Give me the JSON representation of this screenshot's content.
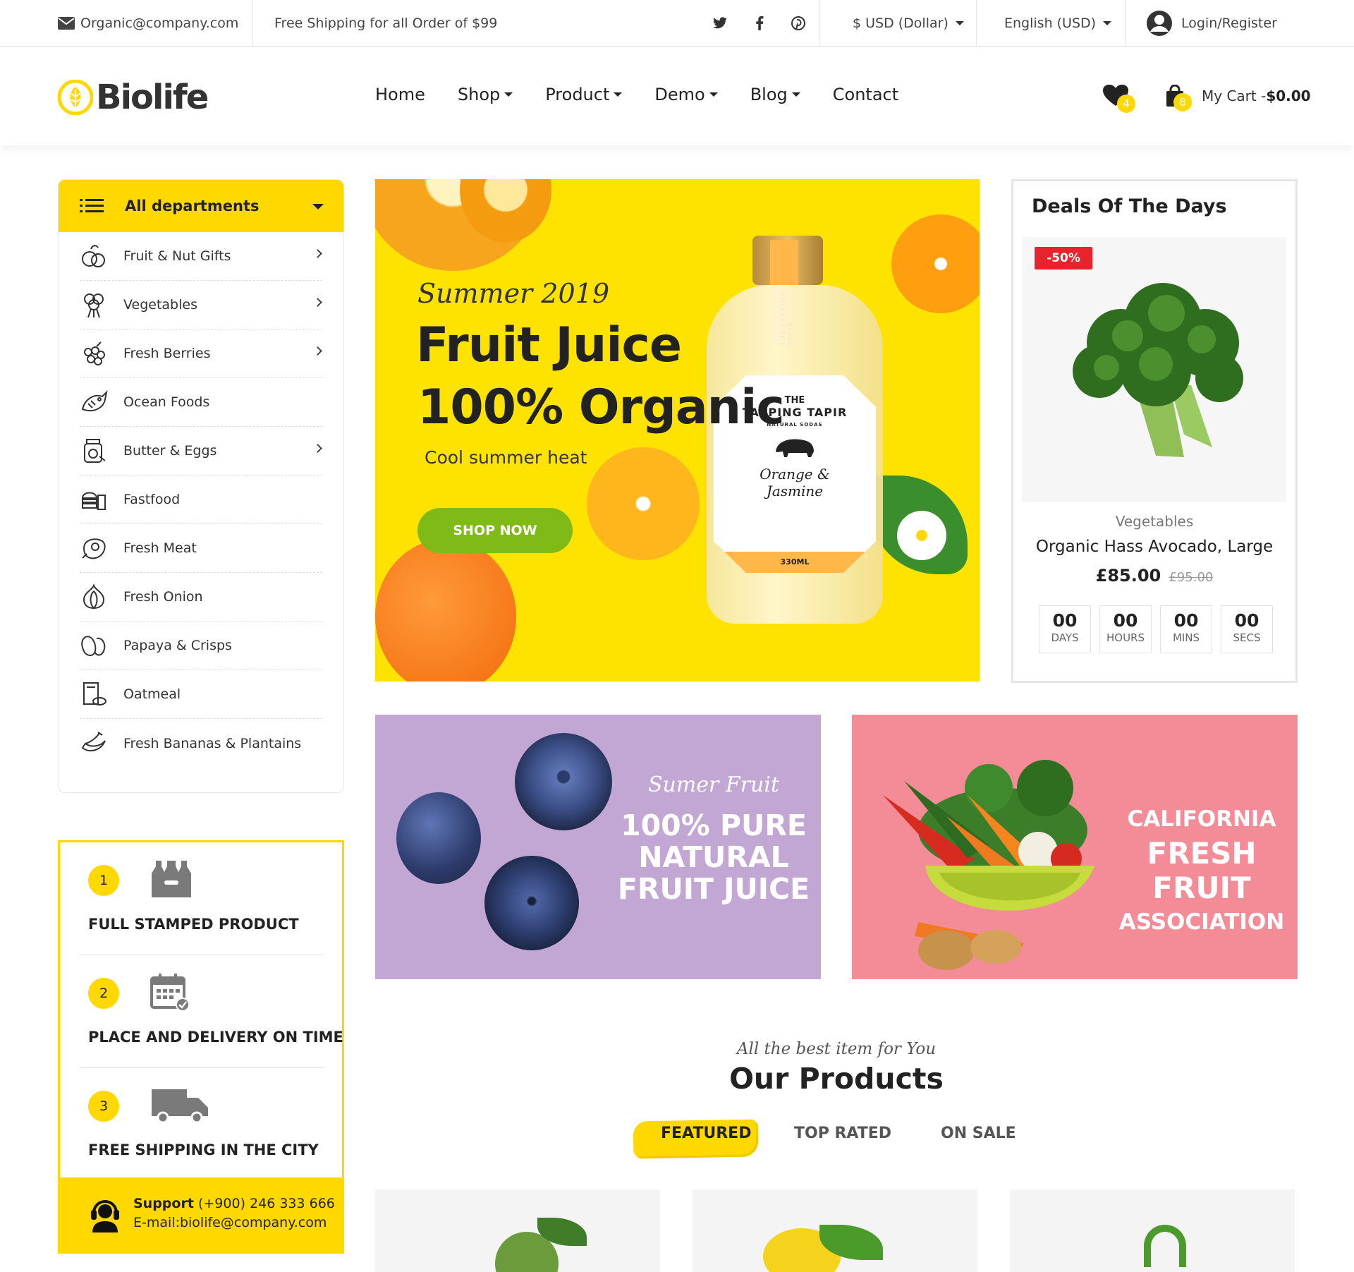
{
  "topbar": {
    "email": "Organic@company.com",
    "shipping": "Free Shipping for all Order of $99",
    "currency": "$ USD (Dollar)",
    "language": "English (USD)",
    "login": "Login/Register"
  },
  "header": {
    "logo": "Biolife",
    "nav": [
      "Home",
      "Shop",
      "Product",
      "Demo",
      "Blog",
      "Contact"
    ],
    "wishlist_count": "4",
    "cart_count": "8",
    "cart_label": "My Cart -",
    "cart_total": "$0.00"
  },
  "departments": {
    "title": "All departments",
    "items": [
      {
        "label": "Fruit & Nut Gifts",
        "icon": "fruit-icon",
        "has_sub": true
      },
      {
        "label": "Vegetables",
        "icon": "broccoli-icon",
        "has_sub": true
      },
      {
        "label": "Fresh Berries",
        "icon": "berries-icon",
        "has_sub": true
      },
      {
        "label": "Ocean Foods",
        "icon": "fish-icon",
        "has_sub": false
      },
      {
        "label": "Butter & Eggs",
        "icon": "jar-icon",
        "has_sub": true
      },
      {
        "label": "Fastfood",
        "icon": "burger-icon",
        "has_sub": false
      },
      {
        "label": "Fresh Meat",
        "icon": "meat-icon",
        "has_sub": false
      },
      {
        "label": "Fresh Onion",
        "icon": "onion-icon",
        "has_sub": false
      },
      {
        "label": "Papaya & Crisps",
        "icon": "papaya-icon",
        "has_sub": false
      },
      {
        "label": "Oatmeal",
        "icon": "oatmeal-icon",
        "has_sub": false
      },
      {
        "label": "Fresh Bananas & Plantains",
        "icon": "banana-icon",
        "has_sub": false
      }
    ]
  },
  "features": [
    {
      "num": "1",
      "title": "FULL STAMPED PRODUCT"
    },
    {
      "num": "2",
      "title": "PLACE AND DELIVERY ON TIME"
    },
    {
      "num": "3",
      "title": "FREE SHIPPING IN THE CITY"
    }
  ],
  "support": {
    "label": "Support",
    "phone": "(+900) 246 333 666",
    "email": "E-mail:biolife@company.com"
  },
  "hero": {
    "kicker": "Summer 2019",
    "title1": "Fruit Juice",
    "title2": "100% Organic",
    "subtitle": "Cool summer heat",
    "button": "SHOP NOW",
    "label_the": "THE",
    "label_brand": "TAPPING TAPIR",
    "label_sub": "NATURAL SODAS",
    "label_flavor1": "Orange &",
    "label_flavor2": "Jasmine",
    "label_volume": "330ML",
    "neck_text": "THE TAPPING TAPIR"
  },
  "deals": {
    "title": "Deals Of The Days",
    "discount": "-50%",
    "category": "Vegetables",
    "name": "Organic Hass Avocado, Large",
    "price": "£85.00",
    "old_price": "£95.00",
    "countdown": [
      {
        "value": "00",
        "unit": "DAYS"
      },
      {
        "value": "00",
        "unit": "HOURS"
      },
      {
        "value": "00",
        "unit": "MINS"
      },
      {
        "value": "00",
        "unit": "SECS"
      }
    ]
  },
  "promo1": {
    "kicker": "Sumer Fruit",
    "line1": "100% PURE",
    "line2": "NATURAL",
    "line3": "FRUIT JUICE"
  },
  "promo2": {
    "line1": "CALIFORNIA",
    "line2": "FRESH FRUIT",
    "line3": "ASSOCIATION"
  },
  "products": {
    "kicker": "All the best item for You",
    "title": "Our Products",
    "tabs": [
      "FEATURED",
      "TOP RATED",
      "ON SALE"
    ]
  },
  "colors": {
    "accent": "#ffd800",
    "green": "#7fba16",
    "sale": "#e8232d",
    "promo_purple": "#c2a6d4",
    "promo_pink": "#f48c98"
  }
}
